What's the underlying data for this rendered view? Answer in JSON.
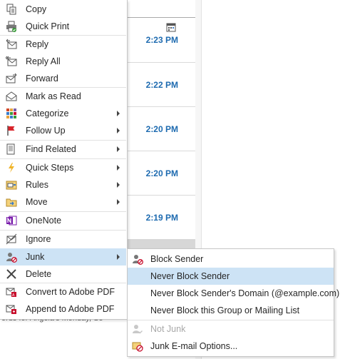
{
  "background_list": {
    "times": [
      "2:23 PM",
      "2:22 PM",
      "2:20 PM",
      "2:20 PM",
      "2:19 PM"
    ],
    "preview_text": "ords for Angela's Monday, Se"
  },
  "menu": {
    "items": [
      {
        "label": "Copy",
        "icon": "copy-icon"
      },
      {
        "label": "Quick Print",
        "icon": "printer-icon"
      },
      {
        "label": "Reply",
        "icon": "reply-icon"
      },
      {
        "label": "Reply All",
        "icon": "reply-all-icon"
      },
      {
        "label": "Forward",
        "icon": "forward-icon"
      },
      {
        "label": "Mark as Read",
        "icon": "envelope-open-icon"
      },
      {
        "label": "Categorize",
        "icon": "category-grid-icon",
        "submenu": true
      },
      {
        "label": "Follow Up",
        "icon": "flag-icon",
        "submenu": true
      },
      {
        "label": "Find Related",
        "icon": "document-search-icon",
        "submenu": true
      },
      {
        "label": "Quick Steps",
        "icon": "lightning-icon",
        "submenu": true
      },
      {
        "label": "Rules",
        "icon": "rules-icon",
        "submenu": true
      },
      {
        "label": "Move",
        "icon": "folder-move-icon",
        "submenu": true
      },
      {
        "label": "OneNote",
        "icon": "onenote-icon"
      },
      {
        "label": "Ignore",
        "icon": "ignore-icon"
      },
      {
        "label": "Junk",
        "icon": "junk-icon",
        "submenu": true,
        "highlighted": true
      },
      {
        "label": "Delete",
        "icon": "delete-x-icon"
      },
      {
        "label": "Convert to Adobe PDF",
        "icon": "adobe-pdf-icon"
      },
      {
        "label": "Append to Adobe PDF",
        "icon": "adobe-pdf-append-icon"
      }
    ]
  },
  "junk_submenu": {
    "items": [
      {
        "label": "Block Sender",
        "icon": "block-sender-icon"
      },
      {
        "label": "Never Block Sender",
        "icon": "",
        "highlighted": true
      },
      {
        "label": "Never Block Sender's Domain (@example.com)",
        "icon": ""
      },
      {
        "label": "Never Block this Group or Mailing List",
        "icon": ""
      },
      {
        "label": "Not Junk",
        "icon": "not-junk-icon",
        "disabled": true
      },
      {
        "label": "Junk E-mail Options...",
        "icon": "junk-options-icon"
      }
    ]
  },
  "colors": {
    "highlight": "#cde3f5",
    "time_text": "#1e6bb0",
    "accent_red": "#c8102e"
  }
}
